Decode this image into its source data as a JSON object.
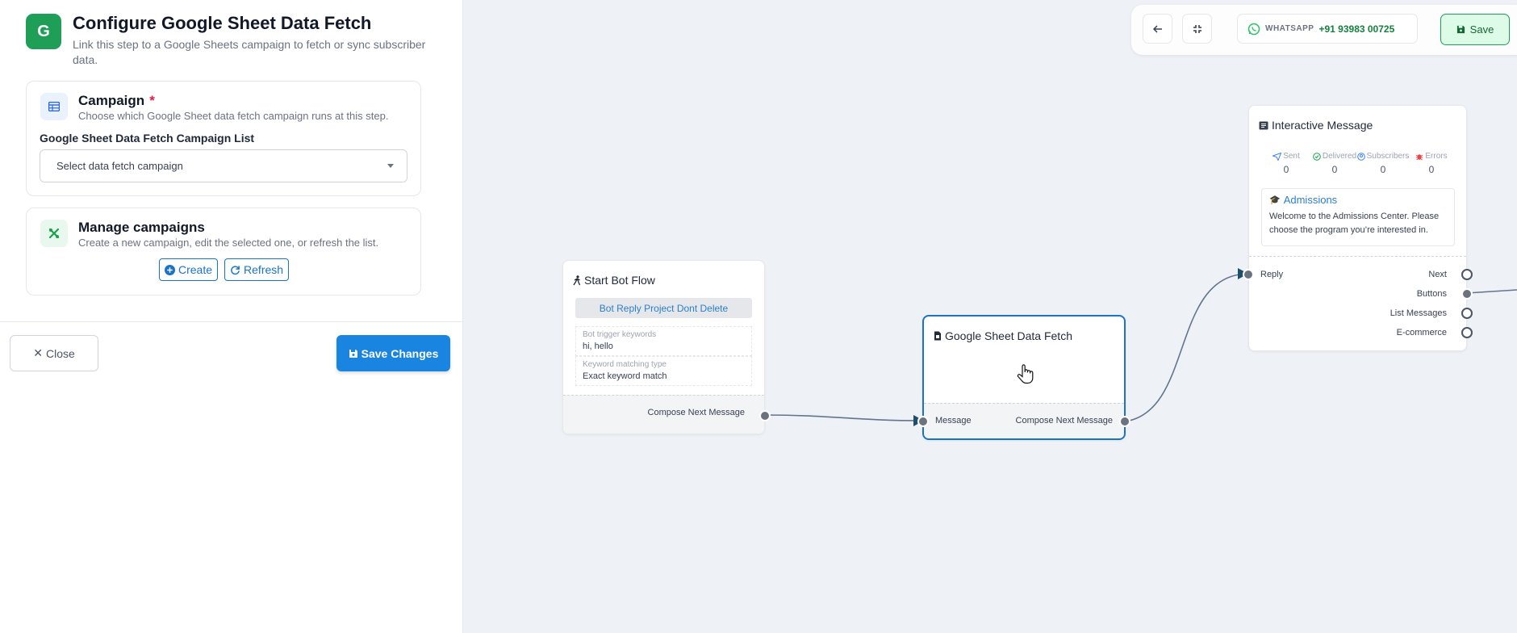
{
  "panel": {
    "icon_letter": "G",
    "title": "Configure Google Sheet Data Fetch",
    "subtitle": "Link this step to a Google Sheets campaign to fetch or sync subscriber data.",
    "campaign": {
      "title": "Campaign",
      "required_mark": "*",
      "subtitle": "Choose which Google Sheet data fetch campaign runs at this step.",
      "field_label": "Google Sheet Data Fetch Campaign List",
      "select_placeholder": "Select data fetch campaign"
    },
    "manage": {
      "title": "Manage campaigns",
      "subtitle": "Create a new campaign, edit the selected one, or refresh the list.",
      "create_label": "Create",
      "refresh_label": "Refresh"
    },
    "close_label": "Close",
    "save_changes_label": "Save Changes"
  },
  "toolbar": {
    "wa_label": "WHATSAPP",
    "wa_number": "+91 93983 00725",
    "save_label": "Save"
  },
  "nodes": {
    "start": {
      "title": "Start Bot Flow",
      "tag": "Bot Reply Project Dont Delete",
      "kw_label": "Bot trigger keywords",
      "kw_value": "hi, hello",
      "match_label": "Keyword matching type",
      "match_value": "Exact keyword match",
      "out_label": "Compose Next Message"
    },
    "gsheet": {
      "title": "Google Sheet Data Fetch",
      "in_label": "Message",
      "out_label": "Compose Next Message"
    },
    "interactive": {
      "title": "Interactive Message",
      "stats": [
        {
          "label": "Sent",
          "value": "0"
        },
        {
          "label": "Delivered",
          "value": "0"
        },
        {
          "label": "Subscribers",
          "value": "0"
        },
        {
          "label": "Errors",
          "value": "0"
        }
      ],
      "msg_title": "Admissions",
      "msg_body": "Welcome to the Admissions Center. Please choose the program you’re interested in.",
      "in_label": "Reply",
      "outs": [
        "Next",
        "Buttons",
        "List Messages",
        "E-commerce"
      ]
    }
  },
  "colors": {
    "accent": "#1a85e0",
    "brand_green": "#1e9e57",
    "required": "#e11d48"
  }
}
